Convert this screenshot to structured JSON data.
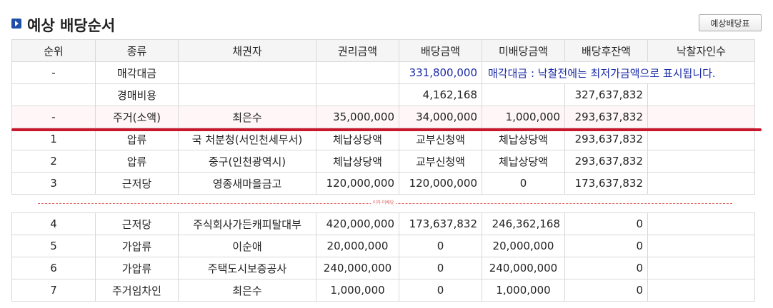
{
  "header": {
    "title": "예상 배당순서",
    "button_label": "예상배당표"
  },
  "table": {
    "columns": [
      "순위",
      "종류",
      "채권자",
      "권리금액",
      "배당금액",
      "미배당금액",
      "배당후잔액",
      "낙찰자인수"
    ],
    "rows_top": [
      {
        "rank": "-",
        "type": "매각대금",
        "creditor": "",
        "right_amount": "",
        "dividend": "331,800,000",
        "notice": "매각대금 : 낙찰전에는 최저가금액으로 표시됩니다."
      },
      {
        "rank": "",
        "type": "경매비용",
        "creditor": "",
        "right_amount": "",
        "dividend": "4,162,168",
        "undivided": "",
        "balance": "327,637,832",
        "takeover": ""
      },
      {
        "rank": "-",
        "type": "주거(소액)",
        "creditor": "최은수",
        "right_amount": "35,000,000",
        "dividend": "34,000,000",
        "undivided": "1,000,000",
        "balance": "293,637,832",
        "takeover": ""
      },
      {
        "rank": "1",
        "type": "압류",
        "creditor": "국 처분청(서인천세무서)",
        "right_amount": "체납상당액",
        "dividend": "교부신청액",
        "undivided": "체납상당액",
        "balance": "293,637,832",
        "takeover": ""
      },
      {
        "rank": "2",
        "type": "압류",
        "creditor": "중구(인천광역시)",
        "right_amount": "체납상당액",
        "dividend": "교부신청액",
        "undivided": "체납상당액",
        "balance": "293,637,832",
        "takeover": ""
      },
      {
        "rank": "3",
        "type": "근저당",
        "creditor": "영종새마을금고",
        "right_amount": "120,000,000",
        "dividend": "120,000,000",
        "undivided": "0",
        "balance": "173,637,832",
        "takeover": ""
      }
    ],
    "separator_label": "이하 미배당",
    "rows_bottom": [
      {
        "rank": "4",
        "type": "근저당",
        "creditor": "주식회사가든캐피탈대부",
        "right_amount": "420,000,000",
        "dividend": "173,637,832",
        "undivided": "246,362,168",
        "balance": "0",
        "takeover": ""
      },
      {
        "rank": "5",
        "type": "가압류",
        "creditor": "이순애",
        "right_amount": "20,000,000",
        "dividend": "0",
        "undivided": "20,000,000",
        "balance": "0",
        "takeover": ""
      },
      {
        "rank": "6",
        "type": "가압류",
        "creditor": "주택도시보증공사",
        "right_amount": "240,000,000",
        "dividend": "0",
        "undivided": "240,000,000",
        "balance": "0",
        "takeover": ""
      },
      {
        "rank": "7",
        "type": "주거임차인",
        "creditor": "최은수",
        "right_amount": "1,000,000",
        "dividend": "0",
        "undivided": "1,000,000",
        "balance": "0",
        "takeover": ""
      }
    ]
  },
  "colors": {
    "accent_blue": "#1a2aa8",
    "title_icon": "#1f4ea8",
    "red_line": "#c8162c"
  }
}
